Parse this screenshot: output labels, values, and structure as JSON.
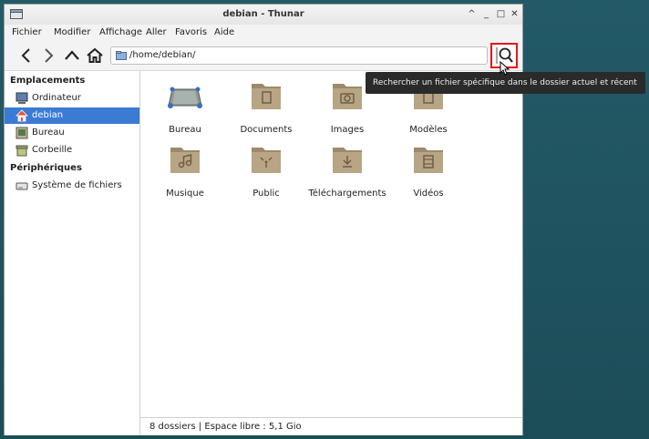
{
  "window": {
    "title": "debian - Thunar",
    "controls": [
      "^",
      "_",
      "□",
      "✕"
    ]
  },
  "menubar": {
    "items": [
      "Fichier",
      "Modifier",
      "Affichage",
      "Aller",
      "Favoris",
      "Aide"
    ]
  },
  "toolbar": {
    "path": "/home/debian/",
    "back_icon": "chevron-left-icon",
    "forward_icon": "chevron-right-icon",
    "up_icon": "arrow-up-icon",
    "home_icon": "home-icon",
    "search_icon": "search-icon"
  },
  "sidebar": {
    "sections": [
      {
        "heading": "Emplacements"
      },
      {
        "heading": "Périphériques"
      }
    ],
    "items": [
      {
        "label": "Ordinateur",
        "icon": "computer-icon",
        "selected": false
      },
      {
        "label": "debian",
        "icon": "home-folder-icon",
        "selected": true
      },
      {
        "label": "Bureau",
        "icon": "desktop-icon",
        "selected": false
      },
      {
        "label": "Corbeille",
        "icon": "trash-icon",
        "selected": false
      },
      {
        "label": "Système de fichiers",
        "icon": "drive-icon",
        "selected": false
      }
    ]
  },
  "files": [
    {
      "label": "Bureau",
      "icon": "desktop-folder-icon"
    },
    {
      "label": "Documents",
      "icon": "documents-folder-icon"
    },
    {
      "label": "Images",
      "icon": "pictures-folder-icon"
    },
    {
      "label": "Modèles",
      "icon": "templates-folder-icon"
    },
    {
      "label": "Musique",
      "icon": "music-folder-icon"
    },
    {
      "label": "Public",
      "icon": "public-folder-icon"
    },
    {
      "label": "Téléchargements",
      "icon": "downloads-folder-icon"
    },
    {
      "label": "Vidéos",
      "icon": "videos-folder-icon"
    }
  ],
  "statusbar": {
    "text": "8 dossiers  |  Espace libre : 5,1 Gio"
  },
  "tooltip": {
    "text": "Rechercher un fichier spécifique dans le dossier actuel et récent"
  },
  "colors": {
    "selection": "#3b7bd4",
    "highlight": "#e3161b",
    "folder": "#b09a7c",
    "desktop": "#1d4f5c"
  }
}
